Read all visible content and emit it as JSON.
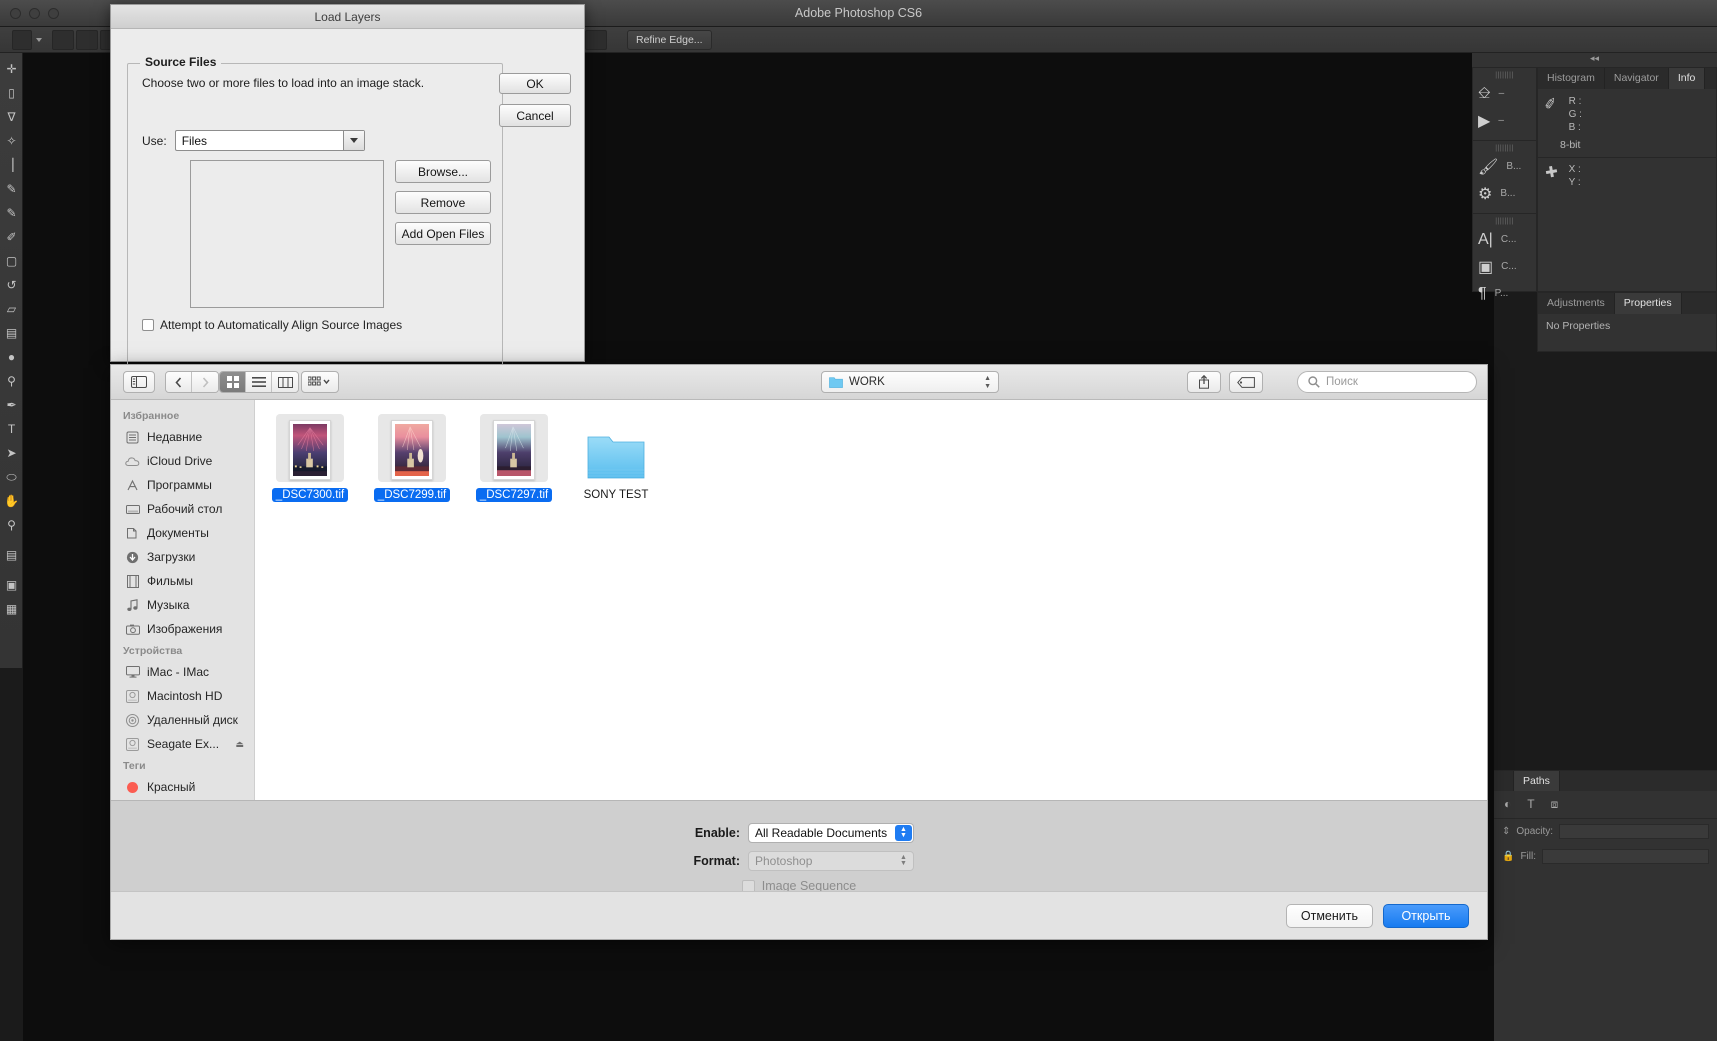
{
  "app": {
    "title": "Adobe Photoshop CS6",
    "option_bar": {
      "refine_edge_label": "Refine Edge..."
    }
  },
  "tools": {
    "items": [
      {
        "name": "move-tool",
        "glyph": "✛"
      },
      {
        "name": "rectangular-marquee-tool",
        "glyph": "⬚"
      },
      {
        "name": "lasso-tool",
        "glyph": "⌇"
      },
      {
        "name": "quick-selection-tool",
        "glyph": "✧"
      },
      {
        "name": "crop-tool",
        "glyph": "⌗"
      },
      {
        "name": "eyedropper-tool",
        "glyph": "✐"
      },
      {
        "name": "spot-healing-brush-tool",
        "glyph": "✒"
      },
      {
        "name": "brush-tool",
        "glyph": "✎"
      },
      {
        "name": "clone-stamp-tool",
        "glyph": "⚑"
      },
      {
        "name": "history-brush-tool",
        "glyph": "↺"
      },
      {
        "name": "eraser-tool",
        "glyph": "▱"
      },
      {
        "name": "gradient-tool",
        "glyph": "▤"
      },
      {
        "name": "blur-tool",
        "glyph": "●"
      },
      {
        "name": "dodge-tool",
        "glyph": "○"
      },
      {
        "name": "pen-tool",
        "glyph": "✒"
      },
      {
        "name": "horizontal-type-tool",
        "glyph": "T"
      },
      {
        "name": "path-selection-tool",
        "glyph": "➤"
      },
      {
        "name": "ellipse-tool",
        "glyph": "⬭"
      },
      {
        "name": "hand-tool",
        "glyph": "✋"
      },
      {
        "name": "zoom-tool",
        "glyph": "⚲"
      }
    ]
  },
  "dock": {
    "collapse_glyph": "◂◂",
    "groups": [
      {
        "rows": [
          {
            "name": "history-mini-icon",
            "label": "–"
          },
          {
            "name": "actions-play-icon",
            "label": "–"
          }
        ]
      },
      {
        "rows": [
          {
            "name": "brush-mini-icon",
            "label": "B..."
          },
          {
            "name": "brush-presets-mini-icon",
            "label": "B..."
          }
        ]
      },
      {
        "rows": [
          {
            "name": "character-mini-icon",
            "label": "C..."
          },
          {
            "name": "clone-source-mini-icon",
            "label": "C..."
          },
          {
            "name": "paragraph-mini-icon",
            "label": "P..."
          }
        ]
      }
    ]
  },
  "info_panel": {
    "tabs": [
      "Histogram",
      "Navigator",
      "Info"
    ],
    "active_tab": "Info",
    "rgb_labels": [
      "R :",
      "G :",
      "B :"
    ],
    "bit_depth": "8-bit",
    "xy_labels": [
      "X :",
      "Y :"
    ]
  },
  "properties_panel": {
    "tabs": [
      "Adjustments",
      "Properties"
    ],
    "active_tab": "Properties",
    "empty_text": "No Properties"
  },
  "layers_panel": {
    "tabs": [
      "Paths"
    ],
    "active_tab": "Paths",
    "icons": [
      "fill-path-icon",
      "text-path-icon",
      "path-bounds-icon"
    ],
    "opacity_label": "Opacity:",
    "fill_label": "Fill:",
    "lock_icon": "lock-icon"
  },
  "load_layers_dialog": {
    "title": "Load Layers",
    "group_legend": "Source Files",
    "description": "Choose two or more files to load into an image stack.",
    "use_label": "Use:",
    "use_value": "Files",
    "file_list_items": [],
    "buttons": {
      "browse": "Browse...",
      "remove": "Remove",
      "add_open_files": "Add Open Files",
      "ok": "OK",
      "cancel": "Cancel"
    },
    "align_checkbox_label": "Attempt to Automatically Align Source Images",
    "align_checkbox_checked": false
  },
  "finder_sheet": {
    "toolbar": {
      "sidebar_toggle_icon": "sidebar-toggle-icon",
      "back_icon": "chevron-left-icon",
      "forward_icon": "chevron-right-icon",
      "view_icons": [
        "icon-view-icon",
        "list-view-icon",
        "column-view-icon"
      ],
      "active_view": "icon-view-icon",
      "arrange_icon": "arrange-icon",
      "path_label": "WORK",
      "path_folder_icon": "folder-icon",
      "share_icon": "share-icon",
      "tag_icon": "tag-icon",
      "search_icon": "search-icon",
      "search_placeholder": "Поиск"
    },
    "sidebar": {
      "sections": [
        {
          "header": "Избранное",
          "items": [
            {
              "label": "Недавние",
              "icon": "recents-icon"
            },
            {
              "label": "iCloud Drive",
              "icon": "cloud-icon"
            },
            {
              "label": "Программы",
              "icon": "applications-icon"
            },
            {
              "label": "Рабочий стол",
              "icon": "desktop-icon"
            },
            {
              "label": "Документы",
              "icon": "documents-icon"
            },
            {
              "label": "Загрузки",
              "icon": "downloads-icon"
            },
            {
              "label": "Фильмы",
              "icon": "movies-icon"
            },
            {
              "label": "Музыка",
              "icon": "music-icon"
            },
            {
              "label": "Изображения",
              "icon": "pictures-icon"
            }
          ]
        },
        {
          "header": "Устройства",
          "items": [
            {
              "label": "iMac - IMac",
              "icon": "imac-icon"
            },
            {
              "label": "Macintosh HD",
              "icon": "harddisk-icon"
            },
            {
              "label": "Удаленный диск",
              "icon": "remote-disc-icon"
            },
            {
              "label": "Seagate Ex...",
              "icon": "external-drive-icon",
              "eject": "⏏"
            }
          ]
        },
        {
          "header": "Теги",
          "items": [
            {
              "label": "Красный",
              "icon": "red-tag-dot-icon"
            }
          ]
        }
      ]
    },
    "files": [
      {
        "name": "_DSC7300.tif",
        "type": "image",
        "selected": true
      },
      {
        "name": "_DSC7299.tif",
        "type": "image",
        "selected": true
      },
      {
        "name": "_DSC7297.tif",
        "type": "image",
        "selected": true
      },
      {
        "name": "SONY TEST",
        "type": "folder",
        "selected": false
      }
    ],
    "options": {
      "enable_label": "Enable:",
      "enable_value": "All Readable Documents",
      "format_label": "Format:",
      "format_value": "Photoshop",
      "format_disabled": true,
      "image_sequence_label": "Image Sequence",
      "image_sequence_checked": false
    },
    "footer": {
      "cancel": "Отменить",
      "open": "Открыть"
    }
  },
  "colors": {
    "accent_blue": "#0a6cf1",
    "default_button": "#177bf0",
    "tag_red": "#fb5c51",
    "folder_blue": "#6fc9f2"
  }
}
